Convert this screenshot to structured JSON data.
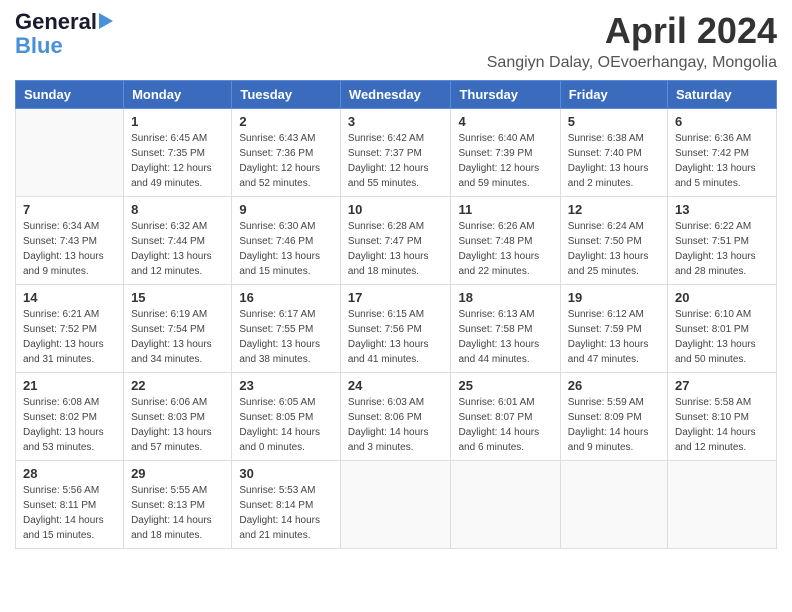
{
  "logo": {
    "line1": "General",
    "line2": "Blue"
  },
  "title": "April 2024",
  "location": "Sangiyn Dalay, OEvoerhangay, Mongolia",
  "weekdays": [
    "Sunday",
    "Monday",
    "Tuesday",
    "Wednesday",
    "Thursday",
    "Friday",
    "Saturday"
  ],
  "weeks": [
    [
      {
        "day": "",
        "info": ""
      },
      {
        "day": "1",
        "info": "Sunrise: 6:45 AM\nSunset: 7:35 PM\nDaylight: 12 hours\nand 49 minutes."
      },
      {
        "day": "2",
        "info": "Sunrise: 6:43 AM\nSunset: 7:36 PM\nDaylight: 12 hours\nand 52 minutes."
      },
      {
        "day": "3",
        "info": "Sunrise: 6:42 AM\nSunset: 7:37 PM\nDaylight: 12 hours\nand 55 minutes."
      },
      {
        "day": "4",
        "info": "Sunrise: 6:40 AM\nSunset: 7:39 PM\nDaylight: 12 hours\nand 59 minutes."
      },
      {
        "day": "5",
        "info": "Sunrise: 6:38 AM\nSunset: 7:40 PM\nDaylight: 13 hours\nand 2 minutes."
      },
      {
        "day": "6",
        "info": "Sunrise: 6:36 AM\nSunset: 7:42 PM\nDaylight: 13 hours\nand 5 minutes."
      }
    ],
    [
      {
        "day": "7",
        "info": "Sunrise: 6:34 AM\nSunset: 7:43 PM\nDaylight: 13 hours\nand 9 minutes."
      },
      {
        "day": "8",
        "info": "Sunrise: 6:32 AM\nSunset: 7:44 PM\nDaylight: 13 hours\nand 12 minutes."
      },
      {
        "day": "9",
        "info": "Sunrise: 6:30 AM\nSunset: 7:46 PM\nDaylight: 13 hours\nand 15 minutes."
      },
      {
        "day": "10",
        "info": "Sunrise: 6:28 AM\nSunset: 7:47 PM\nDaylight: 13 hours\nand 18 minutes."
      },
      {
        "day": "11",
        "info": "Sunrise: 6:26 AM\nSunset: 7:48 PM\nDaylight: 13 hours\nand 22 minutes."
      },
      {
        "day": "12",
        "info": "Sunrise: 6:24 AM\nSunset: 7:50 PM\nDaylight: 13 hours\nand 25 minutes."
      },
      {
        "day": "13",
        "info": "Sunrise: 6:22 AM\nSunset: 7:51 PM\nDaylight: 13 hours\nand 28 minutes."
      }
    ],
    [
      {
        "day": "14",
        "info": "Sunrise: 6:21 AM\nSunset: 7:52 PM\nDaylight: 13 hours\nand 31 minutes."
      },
      {
        "day": "15",
        "info": "Sunrise: 6:19 AM\nSunset: 7:54 PM\nDaylight: 13 hours\nand 34 minutes."
      },
      {
        "day": "16",
        "info": "Sunrise: 6:17 AM\nSunset: 7:55 PM\nDaylight: 13 hours\nand 38 minutes."
      },
      {
        "day": "17",
        "info": "Sunrise: 6:15 AM\nSunset: 7:56 PM\nDaylight: 13 hours\nand 41 minutes."
      },
      {
        "day": "18",
        "info": "Sunrise: 6:13 AM\nSunset: 7:58 PM\nDaylight: 13 hours\nand 44 minutes."
      },
      {
        "day": "19",
        "info": "Sunrise: 6:12 AM\nSunset: 7:59 PM\nDaylight: 13 hours\nand 47 minutes."
      },
      {
        "day": "20",
        "info": "Sunrise: 6:10 AM\nSunset: 8:01 PM\nDaylight: 13 hours\nand 50 minutes."
      }
    ],
    [
      {
        "day": "21",
        "info": "Sunrise: 6:08 AM\nSunset: 8:02 PM\nDaylight: 13 hours\nand 53 minutes."
      },
      {
        "day": "22",
        "info": "Sunrise: 6:06 AM\nSunset: 8:03 PM\nDaylight: 13 hours\nand 57 minutes."
      },
      {
        "day": "23",
        "info": "Sunrise: 6:05 AM\nSunset: 8:05 PM\nDaylight: 14 hours\nand 0 minutes."
      },
      {
        "day": "24",
        "info": "Sunrise: 6:03 AM\nSunset: 8:06 PM\nDaylight: 14 hours\nand 3 minutes."
      },
      {
        "day": "25",
        "info": "Sunrise: 6:01 AM\nSunset: 8:07 PM\nDaylight: 14 hours\nand 6 minutes."
      },
      {
        "day": "26",
        "info": "Sunrise: 5:59 AM\nSunset: 8:09 PM\nDaylight: 14 hours\nand 9 minutes."
      },
      {
        "day": "27",
        "info": "Sunrise: 5:58 AM\nSunset: 8:10 PM\nDaylight: 14 hours\nand 12 minutes."
      }
    ],
    [
      {
        "day": "28",
        "info": "Sunrise: 5:56 AM\nSunset: 8:11 PM\nDaylight: 14 hours\nand 15 minutes."
      },
      {
        "day": "29",
        "info": "Sunrise: 5:55 AM\nSunset: 8:13 PM\nDaylight: 14 hours\nand 18 minutes."
      },
      {
        "day": "30",
        "info": "Sunrise: 5:53 AM\nSunset: 8:14 PM\nDaylight: 14 hours\nand 21 minutes."
      },
      {
        "day": "",
        "info": ""
      },
      {
        "day": "",
        "info": ""
      },
      {
        "day": "",
        "info": ""
      },
      {
        "day": "",
        "info": ""
      }
    ]
  ]
}
